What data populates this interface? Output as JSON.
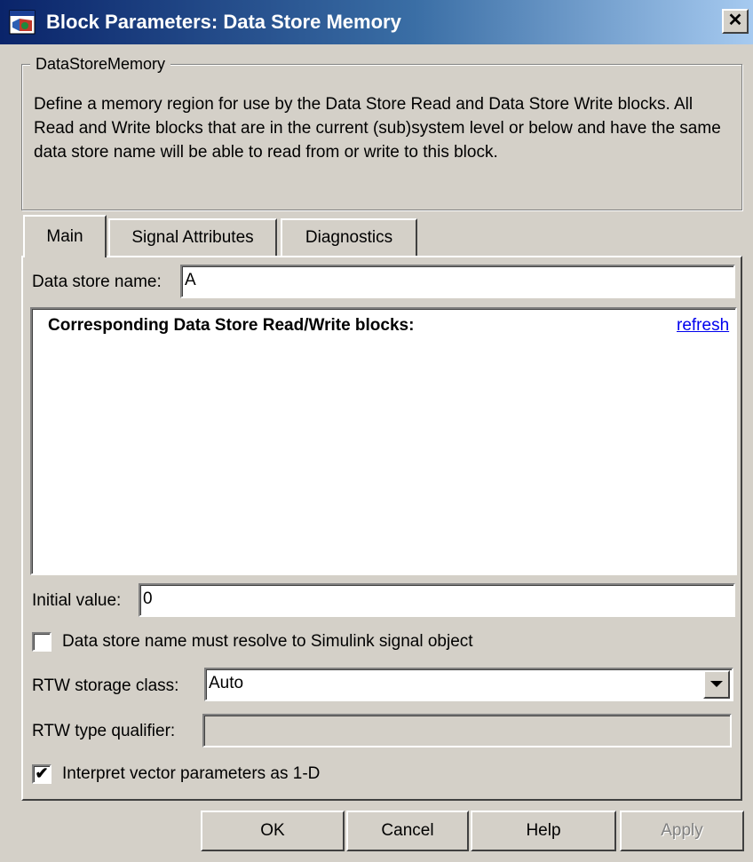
{
  "window": {
    "title": "Block Parameters: Data Store Memory",
    "close_label": "✕"
  },
  "description": {
    "group_label": "DataStoreMemory",
    "text": "Define a memory region for use by the Data Store Read and Data Store Write blocks. All Read and Write blocks that are in the current (sub)system level or below and have the same data store name will be able to read from or write to this block."
  },
  "tabs": [
    {
      "label": "Main",
      "active": true
    },
    {
      "label": "Signal Attributes",
      "active": false
    },
    {
      "label": "Diagnostics",
      "active": false
    }
  ],
  "main": {
    "data_store_name": {
      "label": "Data store name:",
      "value": "A"
    },
    "rw_blocks": {
      "heading": "Corresponding Data Store Read/Write blocks:",
      "refresh_label": "refresh"
    },
    "initial_value": {
      "label": "Initial value:",
      "value": "0"
    },
    "resolve_checkbox": {
      "label": "Data store name must resolve to Simulink signal object",
      "checked": false
    },
    "storage_class": {
      "label": "RTW storage class:",
      "value": "Auto"
    },
    "type_qualifier": {
      "label": "RTW type qualifier:",
      "value": ""
    },
    "interpret_checkbox": {
      "label": "Interpret vector parameters as 1-D",
      "checked": true,
      "mark": "✔"
    }
  },
  "buttons": {
    "ok": "OK",
    "cancel": "Cancel",
    "help": "Help",
    "apply": "Apply"
  },
  "colors": {
    "titlebar_start": "#0a246a",
    "titlebar_end": "#a6caf0",
    "dialog_bg": "#d4d0c8",
    "link": "#0000ee"
  }
}
